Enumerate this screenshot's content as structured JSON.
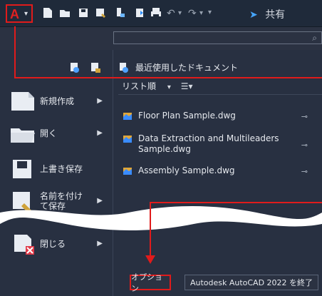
{
  "quick_access": {
    "share_label": "共有"
  },
  "search": {
    "value": "",
    "placeholder": ""
  },
  "left_menu": {
    "items": [
      {
        "label": "新規作成",
        "has_submenu": true
      },
      {
        "label": "開く",
        "has_submenu": true
      },
      {
        "label": "上書き保存",
        "has_submenu": false
      },
      {
        "label": "名前を付けて保存",
        "has_submenu": true
      },
      {
        "label": "閉じる",
        "has_submenu": true
      }
    ]
  },
  "recent": {
    "title": "最近使用したドキュメント",
    "sort_label": "リスト順",
    "files": [
      {
        "name": "Floor Plan Sample.dwg"
      },
      {
        "name": "Data Extraction and Multileaders Sample.dwg"
      },
      {
        "name": "Assembly Sample.dwg"
      }
    ]
  },
  "footer": {
    "options_label": "オプション",
    "exit_label": "Autodesk AutoCAD 2022 を終了"
  },
  "colors": {
    "accent_red": "#e01b1b",
    "background": "#283041",
    "toolbar": "#1f2a3a",
    "share_blue": "#46a6ff"
  }
}
